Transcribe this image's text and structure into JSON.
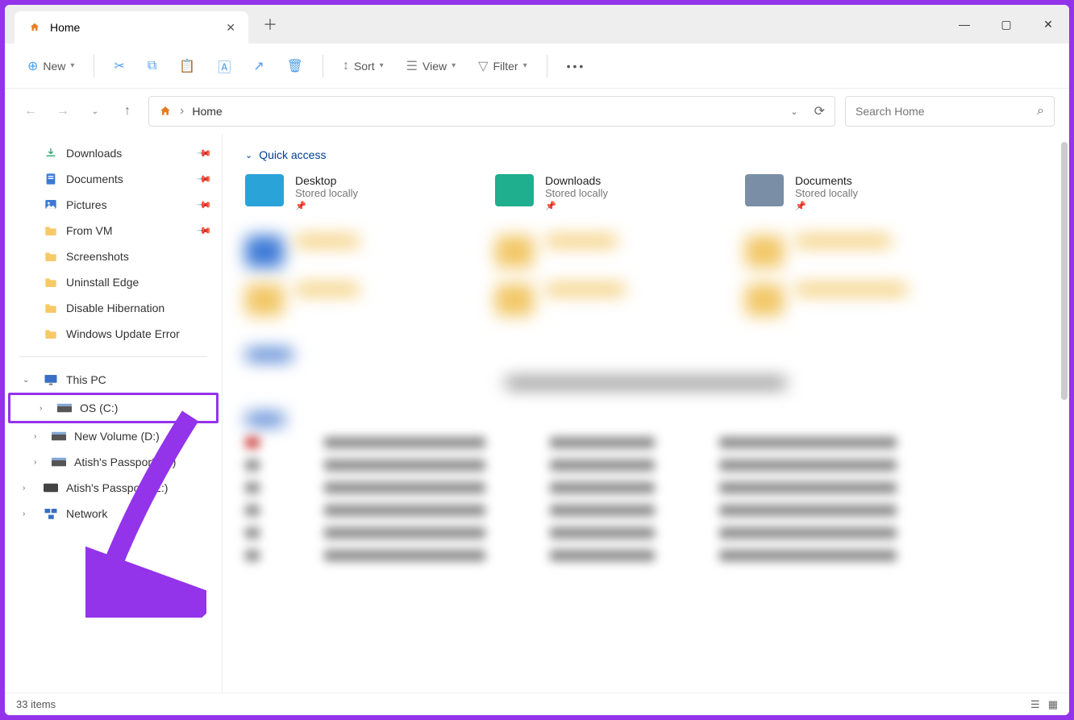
{
  "tab": {
    "title": "Home"
  },
  "toolbar": {
    "new": "New",
    "sort": "Sort",
    "view": "View",
    "filter": "Filter"
  },
  "address": {
    "path": "Home"
  },
  "search": {
    "placeholder": "Search Home"
  },
  "sidebar": {
    "top": [
      {
        "label": "Downloads",
        "icon": "download",
        "pinned": true
      },
      {
        "label": "Documents",
        "icon": "doc",
        "pinned": true
      },
      {
        "label": "Pictures",
        "icon": "picture",
        "pinned": true
      },
      {
        "label": "From VM",
        "icon": "folder",
        "pinned": true
      },
      {
        "label": "Screenshots",
        "icon": "folder",
        "pinned": false
      },
      {
        "label": "Uninstall Edge",
        "icon": "folder",
        "pinned": false
      },
      {
        "label": "Disable Hibernation",
        "icon": "folder",
        "pinned": false
      },
      {
        "label": "Windows Update Error",
        "icon": "folder",
        "pinned": false
      }
    ],
    "thispc": {
      "label": "This PC",
      "drives": [
        {
          "label": "OS (C:)",
          "highlighted": true
        },
        {
          "label": "New Volume (D:)",
          "highlighted": false
        },
        {
          "label": "Atish's Passport  (E:)",
          "highlighted": false
        }
      ]
    },
    "passport": "Atish's Passport  (E:)",
    "network": "Network"
  },
  "content": {
    "section": "Quick access",
    "items": [
      {
        "name": "Desktop",
        "sub": "Stored locally",
        "color": "#2aa3d9"
      },
      {
        "name": "Downloads",
        "sub": "Stored locally",
        "color": "#1fae8e"
      },
      {
        "name": "Documents",
        "sub": "Stored locally",
        "color": "#7a8fa6"
      }
    ]
  },
  "status": {
    "text": "33 items"
  }
}
